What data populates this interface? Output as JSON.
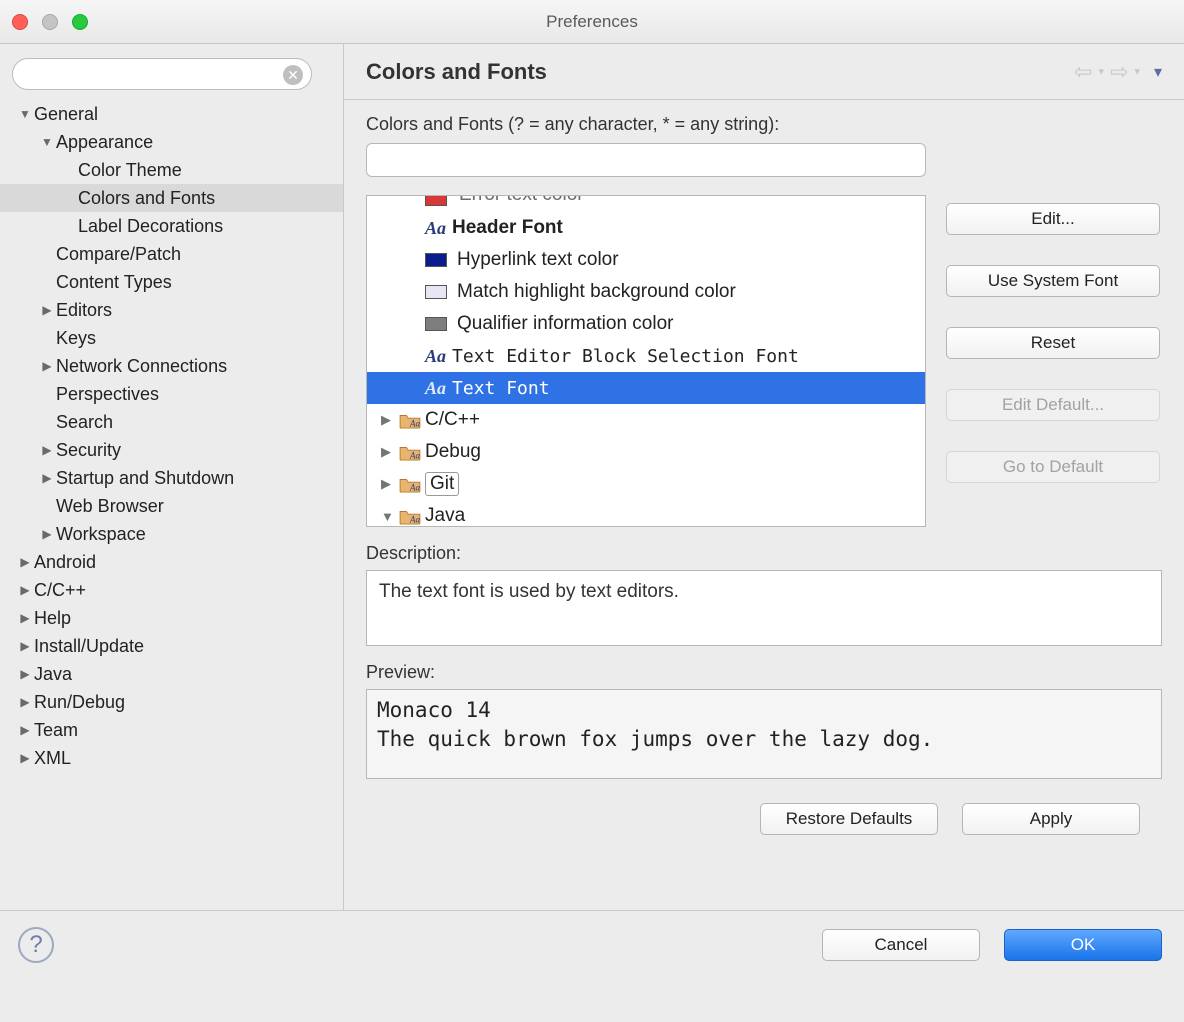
{
  "window": {
    "title": "Preferences"
  },
  "nav": {
    "items": [
      {
        "label": "General",
        "indent": 0,
        "arrow": "down"
      },
      {
        "label": "Appearance",
        "indent": 1,
        "arrow": "down"
      },
      {
        "label": "Color Theme",
        "indent": 2
      },
      {
        "label": "Colors and Fonts",
        "indent": 2,
        "selected": true
      },
      {
        "label": "Label Decorations",
        "indent": 2
      },
      {
        "label": "Compare/Patch",
        "indent": 1
      },
      {
        "label": "Content Types",
        "indent": 1
      },
      {
        "label": "Editors",
        "indent": 1,
        "arrow": "right"
      },
      {
        "label": "Keys",
        "indent": 1
      },
      {
        "label": "Network Connections",
        "indent": 1,
        "arrow": "right"
      },
      {
        "label": "Perspectives",
        "indent": 1
      },
      {
        "label": "Search",
        "indent": 1
      },
      {
        "label": "Security",
        "indent": 1,
        "arrow": "right"
      },
      {
        "label": "Startup and Shutdown",
        "indent": 1,
        "arrow": "right"
      },
      {
        "label": "Web Browser",
        "indent": 1
      },
      {
        "label": "Workspace",
        "indent": 1,
        "arrow": "right"
      },
      {
        "label": "Android",
        "indent": 0,
        "arrow": "right"
      },
      {
        "label": "C/C++",
        "indent": 0,
        "arrow": "right"
      },
      {
        "label": "Help",
        "indent": 0,
        "arrow": "right"
      },
      {
        "label": "Install/Update",
        "indent": 0,
        "arrow": "right"
      },
      {
        "label": "Java",
        "indent": 0,
        "arrow": "right"
      },
      {
        "label": "Run/Debug",
        "indent": 0,
        "arrow": "right"
      },
      {
        "label": "Team",
        "indent": 0,
        "arrow": "right"
      },
      {
        "label": "XML",
        "indent": 0,
        "arrow": "right"
      }
    ]
  },
  "page": {
    "title": "Colors and Fonts",
    "filter_label": "Colors and Fonts (? = any character, * = any string):",
    "list_items": [
      {
        "kind": "color-cut",
        "label": "Error text color",
        "swatch": "#d93838"
      },
      {
        "kind": "font",
        "label": "Header Font",
        "bold": true
      },
      {
        "kind": "color",
        "label": "Hyperlink text color",
        "swatch": "#0a1b8b"
      },
      {
        "kind": "color",
        "label": "Match highlight background color",
        "swatch": "#e8e6f5"
      },
      {
        "kind": "color",
        "label": "Qualifier information color",
        "swatch": "#7d7d7d"
      },
      {
        "kind": "font",
        "label": "Text Editor Block Selection Font",
        "mono": true
      },
      {
        "kind": "font",
        "label": "Text Font",
        "selected": true,
        "mono": true
      },
      {
        "kind": "folder",
        "label": "C/C++",
        "arrow": "right"
      },
      {
        "kind": "folder",
        "label": "Debug",
        "arrow": "right"
      },
      {
        "kind": "folder",
        "label": "Git",
        "arrow": "right",
        "boxed": true
      },
      {
        "kind": "folder",
        "label": "Java",
        "arrow": "down"
      }
    ],
    "buttons": {
      "edit": "Edit...",
      "use_system": "Use System Font",
      "reset": "Reset",
      "edit_default": "Edit Default...",
      "go_to_default": "Go to Default"
    },
    "description_label": "Description:",
    "description_text": "The text font is used by text editors.",
    "preview_label": "Preview:",
    "preview_line1": "Monaco 14",
    "preview_line2": "The quick brown fox jumps over the lazy dog.",
    "restore_defaults": "Restore Defaults",
    "apply": "Apply"
  },
  "footer": {
    "cancel": "Cancel",
    "ok": "OK"
  }
}
